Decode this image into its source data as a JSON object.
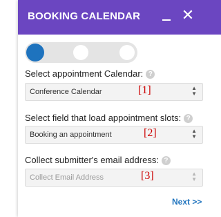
{
  "header": {
    "title": "BOOKING CALENDAR",
    "minimize_icon": "minimize-icon",
    "close_icon": "close-icon",
    "close_glyph": "✕",
    "color": "#6b46c1"
  },
  "stepper": {
    "total_steps": 3,
    "active_step": 1,
    "active_color": "#1e73be"
  },
  "fields": [
    {
      "label": "Select appointment Calendar:",
      "value": "Conference Calendar",
      "marker": "[1]"
    },
    {
      "label": "Select field that load appointment slots:",
      "value": "Booking an appointment",
      "marker": "[2]"
    },
    {
      "label": "Collect submitter's email address:",
      "placeholder": "Collect Email Address",
      "marker": "[3]"
    }
  ],
  "help_glyph": "?",
  "footer": {
    "next_label": "Next >>",
    "color": "#1e73be"
  }
}
